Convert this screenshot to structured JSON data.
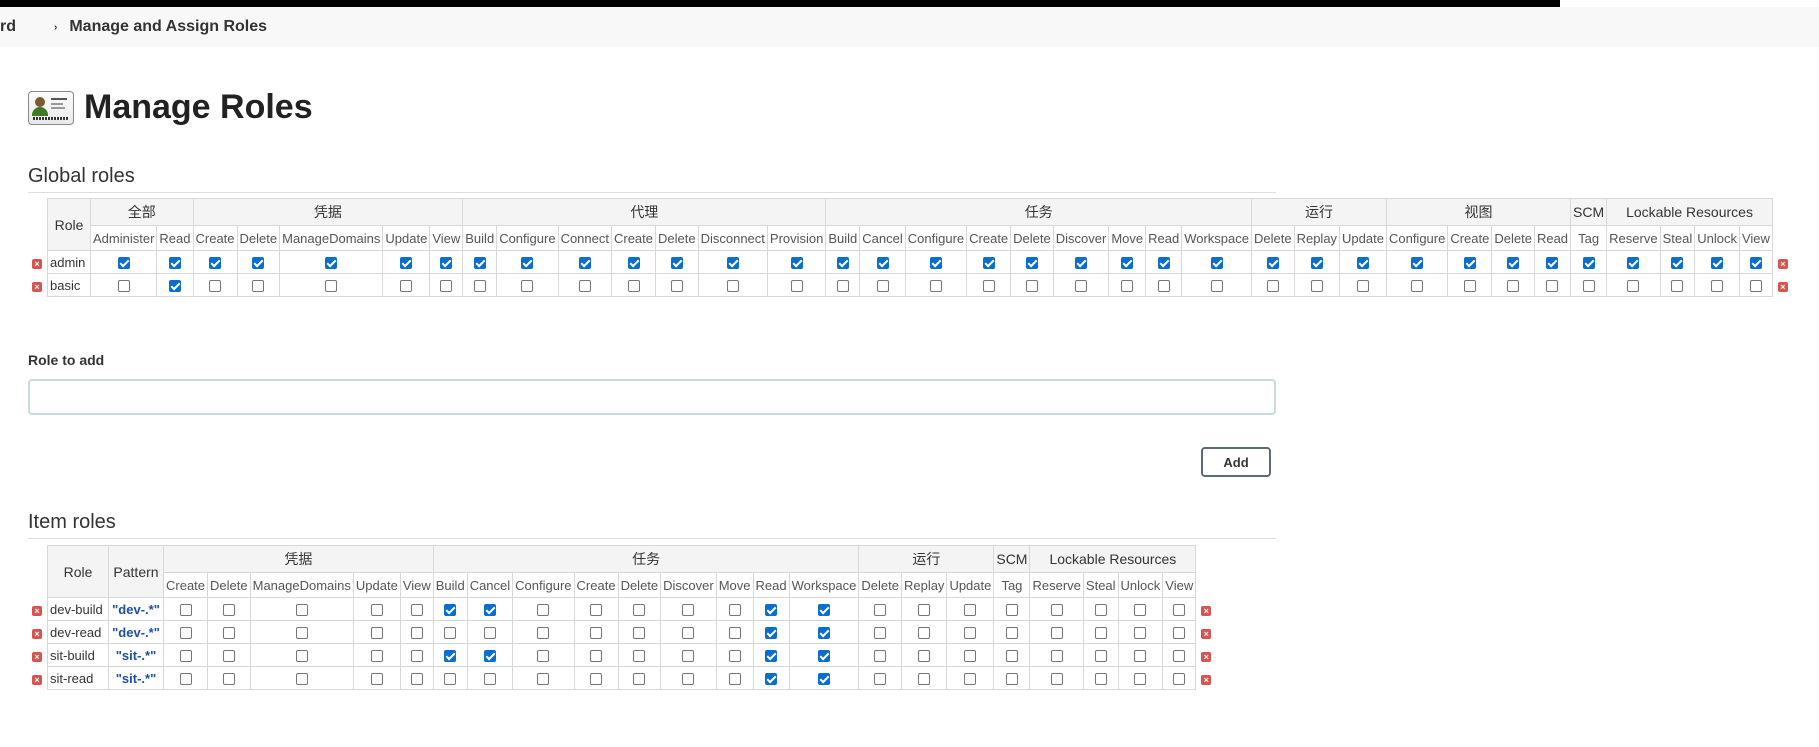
{
  "breadcrumb": {
    "first": "rd",
    "separator": "›",
    "current": "Manage and Assign Roles"
  },
  "page": {
    "title": "Manage Roles"
  },
  "global_roles": {
    "title": "Global roles",
    "role_header": "Role",
    "groups": [
      {
        "label": "全部",
        "perms": [
          "Administer",
          "Read"
        ]
      },
      {
        "label": "凭据",
        "perms": [
          "Create",
          "Delete",
          "ManageDomains",
          "Update",
          "View"
        ]
      },
      {
        "label": "代理",
        "perms": [
          "Build",
          "Configure",
          "Connect",
          "Create",
          "Delete",
          "Disconnect",
          "Provision"
        ]
      },
      {
        "label": "任务",
        "perms": [
          "Build",
          "Cancel",
          "Configure",
          "Create",
          "Delete",
          "Discover",
          "Move",
          "Read",
          "Workspace"
        ]
      },
      {
        "label": "运行",
        "perms": [
          "Delete",
          "Replay",
          "Update"
        ]
      },
      {
        "label": "视图",
        "perms": [
          "Configure",
          "Create",
          "Delete",
          "Read"
        ]
      },
      {
        "label": "SCM",
        "perms": [
          "Tag"
        ]
      },
      {
        "label": "Lockable Resources",
        "perms": [
          "Reserve",
          "Steal",
          "Unlock",
          "View"
        ]
      }
    ],
    "rows": [
      {
        "name": "admin",
        "checks": [
          1,
          1,
          1,
          1,
          1,
          1,
          1,
          1,
          1,
          1,
          1,
          1,
          1,
          1,
          1,
          1,
          1,
          1,
          1,
          1,
          1,
          1,
          1,
          1,
          1,
          1,
          1,
          1,
          1,
          1,
          1,
          1,
          1,
          1,
          1
        ]
      },
      {
        "name": "basic",
        "checks": [
          0,
          1,
          0,
          0,
          0,
          0,
          0,
          0,
          0,
          0,
          0,
          0,
          0,
          0,
          0,
          0,
          0,
          0,
          0,
          0,
          0,
          0,
          0,
          0,
          0,
          0,
          0,
          0,
          0,
          0,
          0,
          0,
          0,
          0,
          0
        ]
      }
    ]
  },
  "role_to_add": {
    "label": "Role to add",
    "value": "",
    "add_button": "Add"
  },
  "item_roles": {
    "title": "Item roles",
    "role_header": "Role",
    "pattern_header": "Pattern",
    "groups": [
      {
        "label": "凭据",
        "perms": [
          "Create",
          "Delete",
          "ManageDomains",
          "Update",
          "View"
        ]
      },
      {
        "label": "任务",
        "perms": [
          "Build",
          "Cancel",
          "Configure",
          "Create",
          "Delete",
          "Discover",
          "Move",
          "Read",
          "Workspace"
        ]
      },
      {
        "label": "运行",
        "perms": [
          "Delete",
          "Replay",
          "Update"
        ]
      },
      {
        "label": "SCM",
        "perms": [
          "Tag"
        ]
      },
      {
        "label": "Lockable Resources",
        "perms": [
          "Reserve",
          "Steal",
          "Unlock",
          "View"
        ]
      }
    ],
    "rows": [
      {
        "name": "dev-build",
        "pattern": "\"dev-.*\"",
        "checks": [
          0,
          0,
          0,
          0,
          0,
          1,
          1,
          0,
          0,
          0,
          0,
          0,
          1,
          1,
          0,
          0,
          0,
          0,
          0,
          0,
          0,
          0
        ]
      },
      {
        "name": "dev-read",
        "pattern": "\"dev-.*\"",
        "checks": [
          0,
          0,
          0,
          0,
          0,
          0,
          0,
          0,
          0,
          0,
          0,
          0,
          1,
          1,
          0,
          0,
          0,
          0,
          0,
          0,
          0,
          0
        ]
      },
      {
        "name": "sit-build",
        "pattern": "\"sit-.*\"",
        "checks": [
          0,
          0,
          0,
          0,
          0,
          1,
          1,
          0,
          0,
          0,
          0,
          0,
          1,
          1,
          0,
          0,
          0,
          0,
          0,
          0,
          0,
          0
        ]
      },
      {
        "name": "sit-read",
        "pattern": "\"sit-.*\"",
        "checks": [
          0,
          0,
          0,
          0,
          0,
          0,
          0,
          0,
          0,
          0,
          0,
          0,
          1,
          1,
          0,
          0,
          0,
          0,
          0,
          0,
          0,
          0
        ]
      }
    ]
  }
}
